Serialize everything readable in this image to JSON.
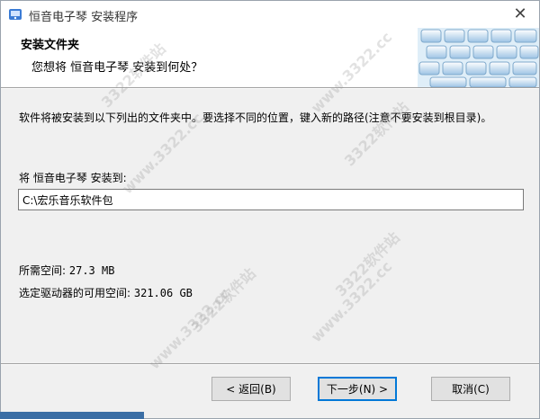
{
  "window": {
    "title": "恒音电子琴 安装程序",
    "close_glyph": "✕"
  },
  "header": {
    "title": "安装文件夹",
    "subtitle": "您想将 恒音电子琴 安装到何处？"
  },
  "body": {
    "description": "软件将被安装到以下列出的文件夹中。要选择不同的位置，键入新的路径(注意不要安装到根目录)。",
    "install_label": "将 恒音电子琴 安装到:",
    "install_path": "C:\\宏乐音乐软件包",
    "required_space_label": "所需空间:",
    "required_space_value": "27.3 MB",
    "available_space_label": "选定驱动器的可用空间:",
    "available_space_value": "321.06 GB"
  },
  "buttons": {
    "back": "< 返回(B)",
    "next": "下一步(N) >",
    "cancel": "取消(C)"
  },
  "watermarks": [
    "3322软件站",
    "www.3322.cc",
    "3322软件站",
    "www.3322.cc",
    "3322软件站",
    "www.3322.cc",
    "3322软件站",
    "www.3322.cc"
  ],
  "colors": {
    "accent": "#0078d7",
    "dialog_bg": "#f0f0f0",
    "header_bg": "#ffffff"
  },
  "icons": {
    "app": "installer-icon",
    "header": "keyboard-keys-icon"
  }
}
